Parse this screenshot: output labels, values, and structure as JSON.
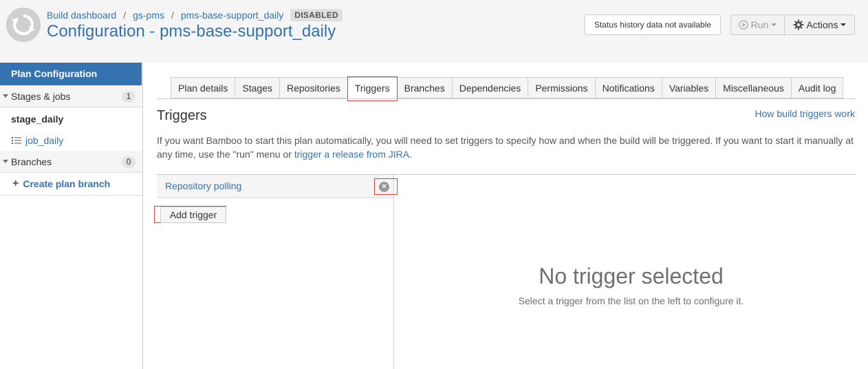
{
  "breadcrumb": {
    "items": [
      "Build dashboard",
      "gs-pms",
      "pms-base-support_daily"
    ],
    "separator": "/",
    "badge": "DISABLED"
  },
  "page": {
    "title": "Configuration - pms-base-support_daily"
  },
  "header_actions": {
    "status_history": "Status history data not available",
    "run_label": "Run",
    "actions_label": "Actions"
  },
  "sidebar": {
    "plan_configuration": "Plan Configuration",
    "stages_label": "Stages & jobs",
    "stages_count": "1",
    "stage_name": "stage_daily",
    "job_name": "job_daily",
    "branches_label": "Branches",
    "branches_count": "0",
    "create_branch": "Create plan branch"
  },
  "tabs": [
    "Plan details",
    "Stages",
    "Repositories",
    "Triggers",
    "Branches",
    "Dependencies",
    "Permissions",
    "Notifications",
    "Variables",
    "Miscellaneous",
    "Audit log"
  ],
  "active_tab": "Triggers",
  "content": {
    "heading": "Triggers",
    "help_link": "How build triggers work",
    "intro_text": "If you want Bamboo to start this plan automatically, you will need to set triggers to specify how and when the build will be triggered. If you want to start it manually at any time, use the \"run\" menu or ",
    "intro_link": "trigger a release from JIRA",
    "intro_end": "."
  },
  "trigger_list": {
    "items": [
      "Repository polling"
    ],
    "add_label": "Add trigger"
  },
  "detail": {
    "empty_title": "No trigger selected",
    "empty_subtitle": "Select a trigger from the list on the left to configure it."
  },
  "colors": {
    "brand_blue": "#3572b0",
    "highlight_red": "#d04437",
    "header_bg": "#f5f5f5"
  }
}
